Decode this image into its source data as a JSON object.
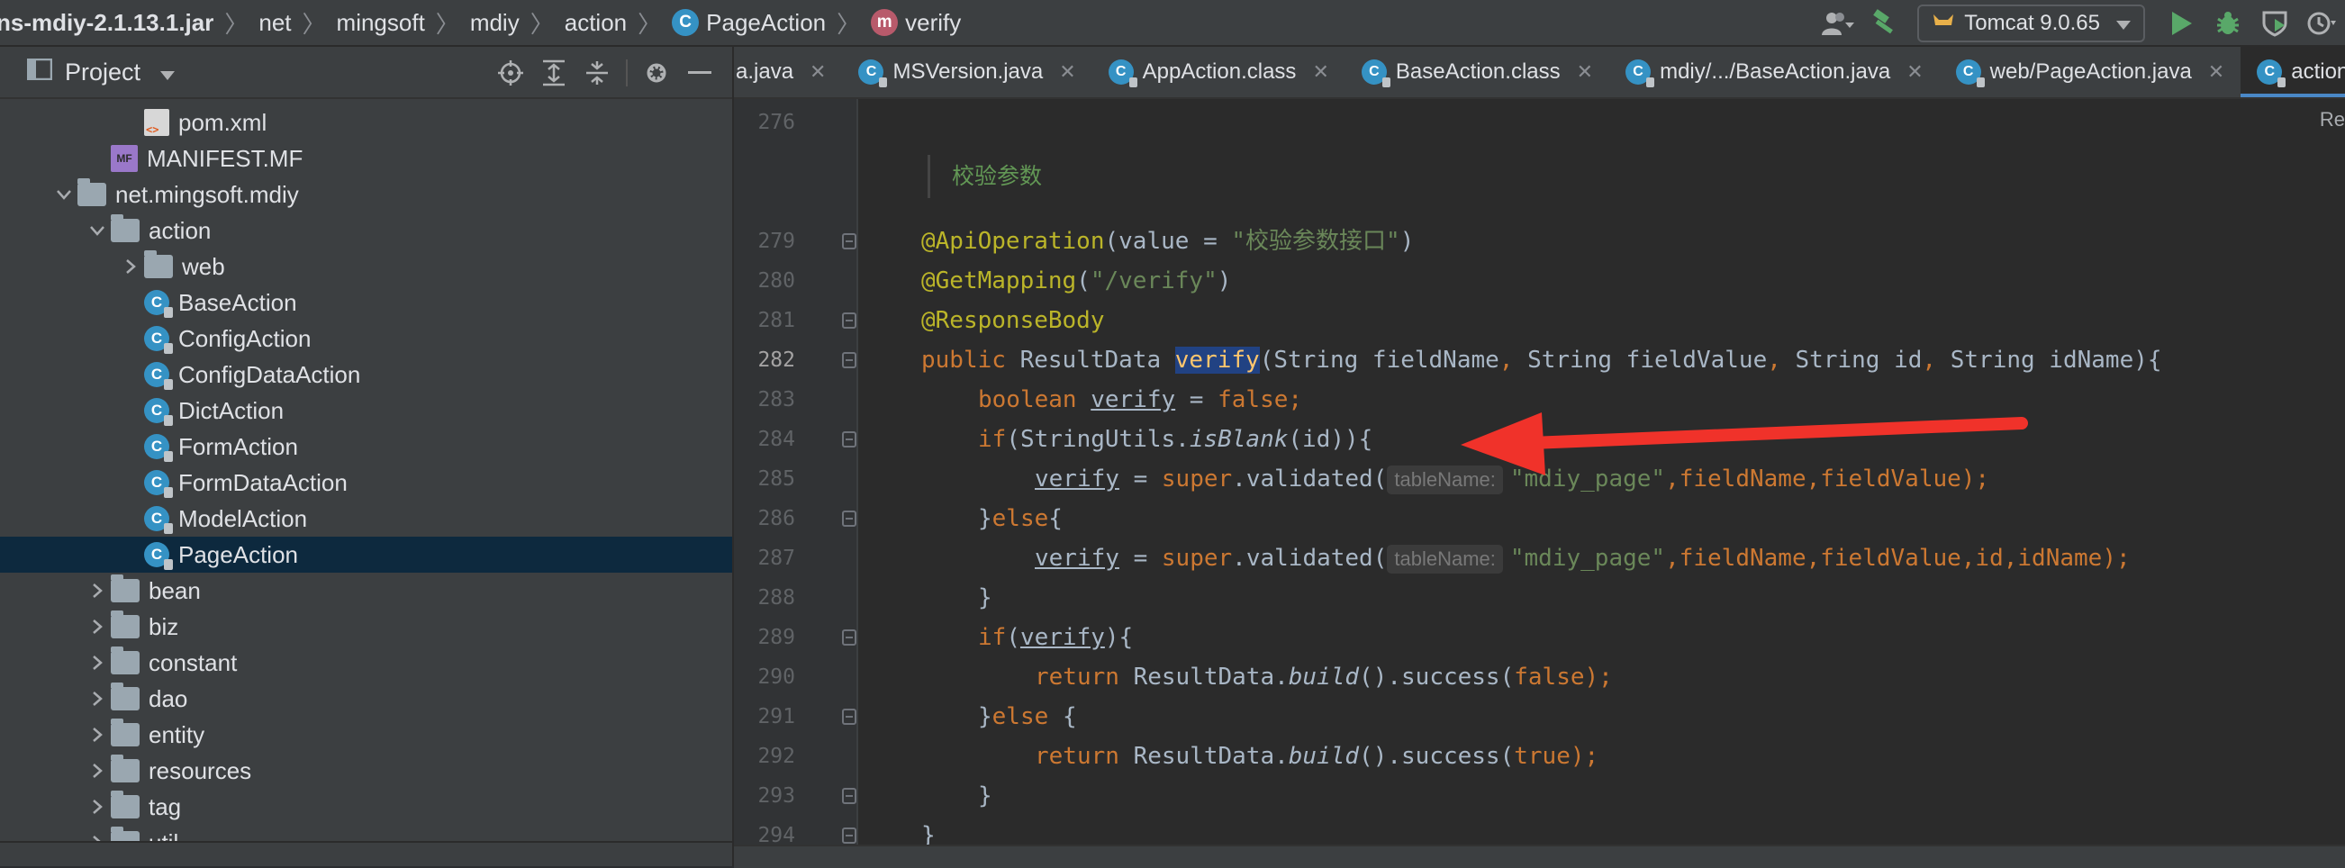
{
  "breadcrumb": {
    "jar": "ns-mdiy-2.1.13.1.jar",
    "segments": [
      "net",
      "mingsoft",
      "mdiy",
      "action"
    ],
    "class_badge": "C",
    "class_name": "PageAction",
    "method_badge": "m",
    "method_name": "verify",
    "separator": "〉"
  },
  "toolbar": {
    "run_config": "Tomcat 9.0.65",
    "icons": [
      "user-icon",
      "hammer-icon",
      "tomcat-icon",
      "run-icon",
      "debug-icon",
      "coverage-icon",
      "profile-icon"
    ]
  },
  "project": {
    "title": "Project",
    "tree": [
      {
        "label": "pom.xml",
        "type": "xml",
        "indent": 4
      },
      {
        "label": "MANIFEST.MF",
        "type": "mf",
        "indent": 3
      },
      {
        "label": "net.mingsoft.mdiy",
        "type": "folder",
        "indent": 2,
        "expanded": true
      },
      {
        "label": "action",
        "type": "folder",
        "indent": 3,
        "expanded": true
      },
      {
        "label": "web",
        "type": "folder",
        "indent": 4,
        "expanded": false
      },
      {
        "label": "BaseAction",
        "type": "class",
        "indent": 4
      },
      {
        "label": "ConfigAction",
        "type": "class",
        "indent": 4
      },
      {
        "label": "ConfigDataAction",
        "type": "class",
        "indent": 4
      },
      {
        "label": "DictAction",
        "type": "class",
        "indent": 4
      },
      {
        "label": "FormAction",
        "type": "class",
        "indent": 4
      },
      {
        "label": "FormDataAction",
        "type": "class",
        "indent": 4
      },
      {
        "label": "ModelAction",
        "type": "class",
        "indent": 4
      },
      {
        "label": "PageAction",
        "type": "class",
        "indent": 4,
        "selected": true
      },
      {
        "label": "bean",
        "type": "folder",
        "indent": 3,
        "expanded": false
      },
      {
        "label": "biz",
        "type": "folder",
        "indent": 3,
        "expanded": false
      },
      {
        "label": "constant",
        "type": "folder",
        "indent": 3,
        "expanded": false
      },
      {
        "label": "dao",
        "type": "folder",
        "indent": 3,
        "expanded": false
      },
      {
        "label": "entity",
        "type": "folder",
        "indent": 3,
        "expanded": false
      },
      {
        "label": "resources",
        "type": "folder",
        "indent": 3,
        "expanded": false
      },
      {
        "label": "tag",
        "type": "folder",
        "indent": 3,
        "expanded": false
      },
      {
        "label": "util",
        "type": "folder",
        "indent": 3,
        "expanded": false
      }
    ]
  },
  "tabs": [
    {
      "label": "a.java",
      "icon": false
    },
    {
      "label": "MSVersion.java",
      "icon": true
    },
    {
      "label": "AppAction.class",
      "icon": true
    },
    {
      "label": "BaseAction.class",
      "icon": true
    },
    {
      "label": "mdiy/.../BaseAction.java",
      "icon": true
    },
    {
      "label": "web/PageAction.java",
      "icon": true
    },
    {
      "label": "action/PageAction.java",
      "icon": true,
      "active": true
    }
  ],
  "editor": {
    "reader_mode": "Re",
    "doc_comment": "校验参数",
    "line_numbers": [
      "276",
      "279",
      "280",
      "281",
      "282",
      "283",
      "284",
      "285",
      "286",
      "287",
      "288",
      "289",
      "290",
      "291",
      "292",
      "293",
      "294"
    ],
    "current_line": "282",
    "code": {
      "l279": {
        "ann": "@ApiOperation",
        "a": "(value = ",
        "s": "\"校验参数接口\"",
        "b": ")"
      },
      "l280": {
        "ann": "@GetMapping",
        "a": "(",
        "s": "\"/verify\"",
        "b": ")"
      },
      "l281": {
        "ann": "@ResponseBody"
      },
      "l282": {
        "kw": "public ",
        "a": "ResultData ",
        "name": "verify",
        "b": "(String fieldName",
        "c1": ", ",
        "d": "String fieldValue",
        "c2": ", ",
        "e": "String id",
        "c3": ", ",
        "f": "String idName){"
      },
      "l283": {
        "kw": "boolean ",
        "v": "verify",
        "a": " = ",
        "kw2": "false",
        "b": ";"
      },
      "l284": {
        "kw": "if",
        "a": "(StringUtils.",
        "m": "isBlank",
        "b": "(id)){"
      },
      "l285": {
        "v": "verify",
        "a": " = ",
        "kw": "super",
        "b": ".validated(",
        "hint": "tableName:",
        "s": "\"mdiy_page\"",
        "c": ",fieldName,fieldValue);"
      },
      "l286": {
        "a": "}",
        "kw": "else",
        "b": "{"
      },
      "l287": {
        "v": "verify",
        "a": " = ",
        "kw": "super",
        "b": ".validated(",
        "hint": "tableName:",
        "s": "\"mdiy_page\"",
        "c": ",fieldName,fieldValue,id,idName);"
      },
      "l288": {
        "a": "}"
      },
      "l289": {
        "kw": "if",
        "a": "(",
        "v": "verify",
        "b": "){"
      },
      "l290": {
        "kw": "return ",
        "a": "ResultData.",
        "m": "build",
        "b": "().success(",
        "kw2": "false",
        "c": ");"
      },
      "l291": {
        "a": "}",
        "kw": "else ",
        "b": "{"
      },
      "l292": {
        "kw": "return ",
        "a": "ResultData.",
        "m": "build",
        "b": "().success(",
        "kw2": "true",
        "c": ");"
      },
      "l293": {
        "a": "}"
      },
      "l294": {
        "a": "}"
      }
    }
  },
  "bottom": {
    "stub": "S"
  },
  "colors": {
    "keyword": "#cc7832",
    "annotation": "#bbb529",
    "string": "#6a8759",
    "arrow": "#f0322a",
    "selection": "#0d293e",
    "accent": "#4a88c7"
  }
}
